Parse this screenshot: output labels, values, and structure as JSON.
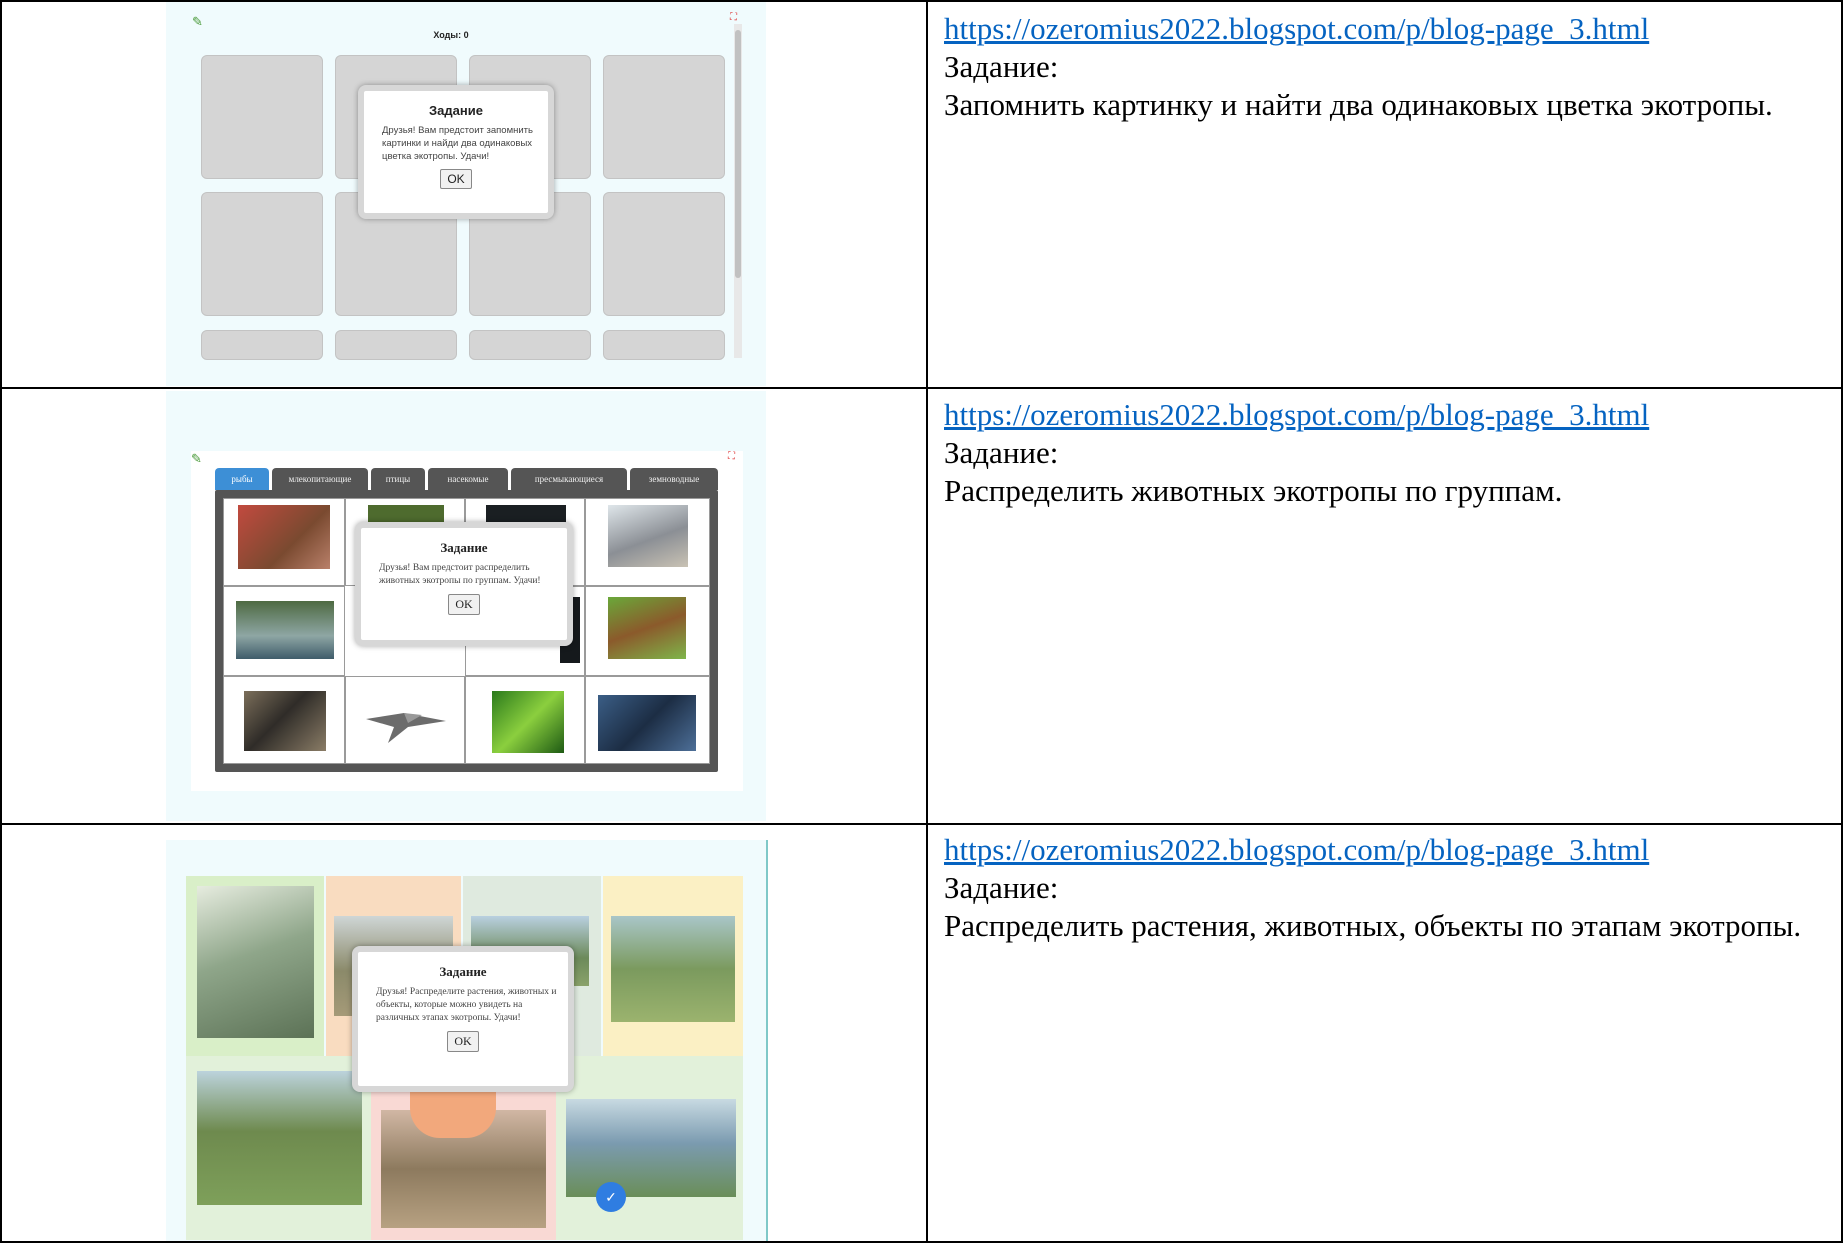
{
  "rows": [
    {
      "link": "https://ozeromius2022.blogspot.com/p/blog-page_3.html",
      "task_label": "Задание:",
      "task_text": "Запомнить картинку и найти два одинаковых цветка экотропы.",
      "shot": {
        "moves": "Ходы: 0",
        "dialog_title": "Задание",
        "dialog_text": "Друзья! Вам предстоит запомнить картинки и найди два одинаковых цветка экотропы. Удачи!",
        "ok_label": "OK"
      }
    },
    {
      "link": "https://ozeromius2022.blogspot.com/p/blog-page_3.html",
      "task_label": "Задание:",
      "task_text": "Распределить животных экотропы по группам.",
      "shot": {
        "tabs": [
          "рыбы",
          "млекопитающие",
          "птицы",
          "насекомые",
          "пресмыкающиеся",
          "земноводные"
        ],
        "dialog_title": "Задание",
        "dialog_text": "Друзья! Вам предстоит распределить животных экотропы по группам. Удачи!",
        "ok_label": "OK"
      }
    },
    {
      "link": "https://ozeromius2022.blogspot.com/p/blog-page_3.html",
      "task_label": "Задание:",
      "task_text": "Распределить растения, животных, объекты по этапам экотропы.",
      "shot": {
        "dialog_title": "Задание",
        "dialog_text": "Друзья! Распределите растения, животных и объекты, которые можно увидеть на различных этапах экотропы. Удачи!",
        "ok_label": "OK"
      }
    }
  ],
  "colors": {
    "link": "#0563c1",
    "tab_active": "#3d8fd6",
    "tab": "#555555"
  }
}
